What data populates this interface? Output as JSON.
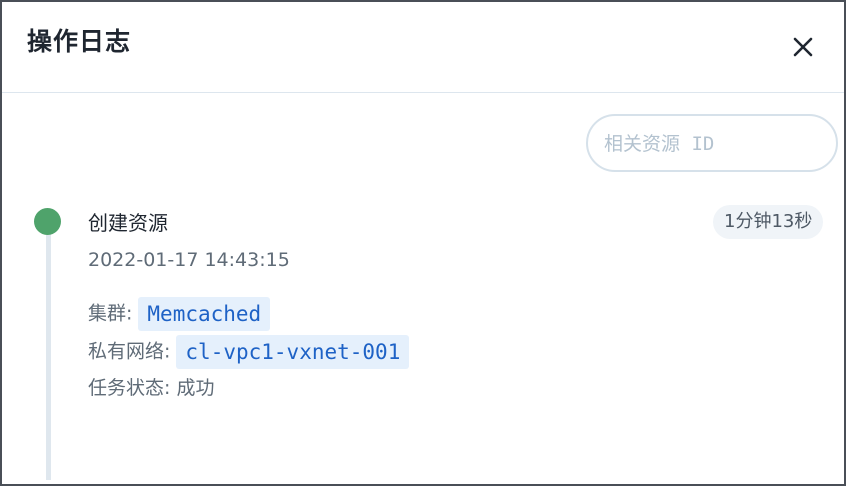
{
  "dialog": {
    "title": "操作日志",
    "close_icon": "close-icon"
  },
  "search": {
    "placeholder": "相关资源 ID",
    "value": ""
  },
  "event": {
    "status_color": "#4fa36b",
    "title": "创建资源",
    "timestamp": "2022-01-17 14:43:15",
    "duration": "1分钟13秒",
    "cluster_label": "集群:",
    "cluster_value": "Memcached",
    "vxnet_label": "私有网络:",
    "vxnet_value": "cl-vpc1-vxnet-001",
    "status_label": "任务状态:",
    "status_value": "成功"
  },
  "colors": {
    "accent": "#1e62c6",
    "tag_bg": "#e5f0fc",
    "success": "#4fa36b"
  }
}
